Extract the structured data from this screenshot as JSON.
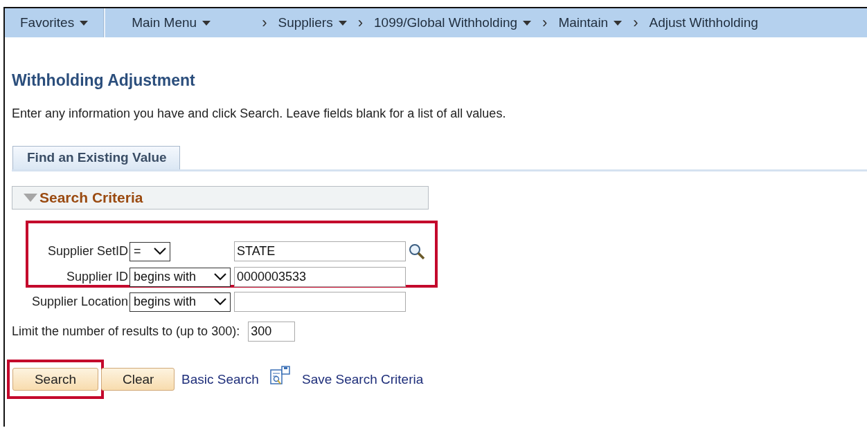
{
  "breadcrumbs": [
    {
      "label": "Favorites",
      "dropdown": true
    },
    {
      "label": "Main Menu",
      "dropdown": true
    },
    {
      "label": "Suppliers",
      "dropdown": true,
      "separator": "›"
    },
    {
      "label": "1099/Global Withholding",
      "dropdown": true,
      "separator": "›"
    },
    {
      "label": "Maintain",
      "dropdown": true,
      "separator": "›"
    },
    {
      "label": "Adjust Withholding",
      "dropdown": false,
      "separator": "›"
    }
  ],
  "page_title": "Withholding Adjustment",
  "instructions": "Enter any information you have and click Search. Leave fields blank for a list of all values.",
  "tabs": [
    {
      "label": "Find an Existing Value",
      "selected": true
    }
  ],
  "section": {
    "title": "Search Criteria",
    "expanded": true
  },
  "criteria_groups": [
    {
      "highlighted": true,
      "rows": [
        {
          "label": "Supplier SetID",
          "operator": "=",
          "value": "STATE",
          "lookup": true
        },
        {
          "label": "Supplier ID",
          "operator": "begins with",
          "value": "0000003533",
          "lookup": false
        }
      ]
    },
    {
      "highlighted": false,
      "rows": [
        {
          "label": "Supplier Location",
          "operator": "begins with",
          "value": "",
          "lookup": false
        }
      ]
    }
  ],
  "limit": {
    "label": "Limit the number of results to (up to 300):",
    "value": "300"
  },
  "buttons": [
    {
      "label": "Search",
      "highlighted": true
    },
    {
      "label": "Clear",
      "highlighted": false
    }
  ],
  "links": [
    {
      "label": "Basic Search",
      "icon": false
    },
    {
      "label": "Save Search Criteria",
      "icon": true
    }
  ]
}
